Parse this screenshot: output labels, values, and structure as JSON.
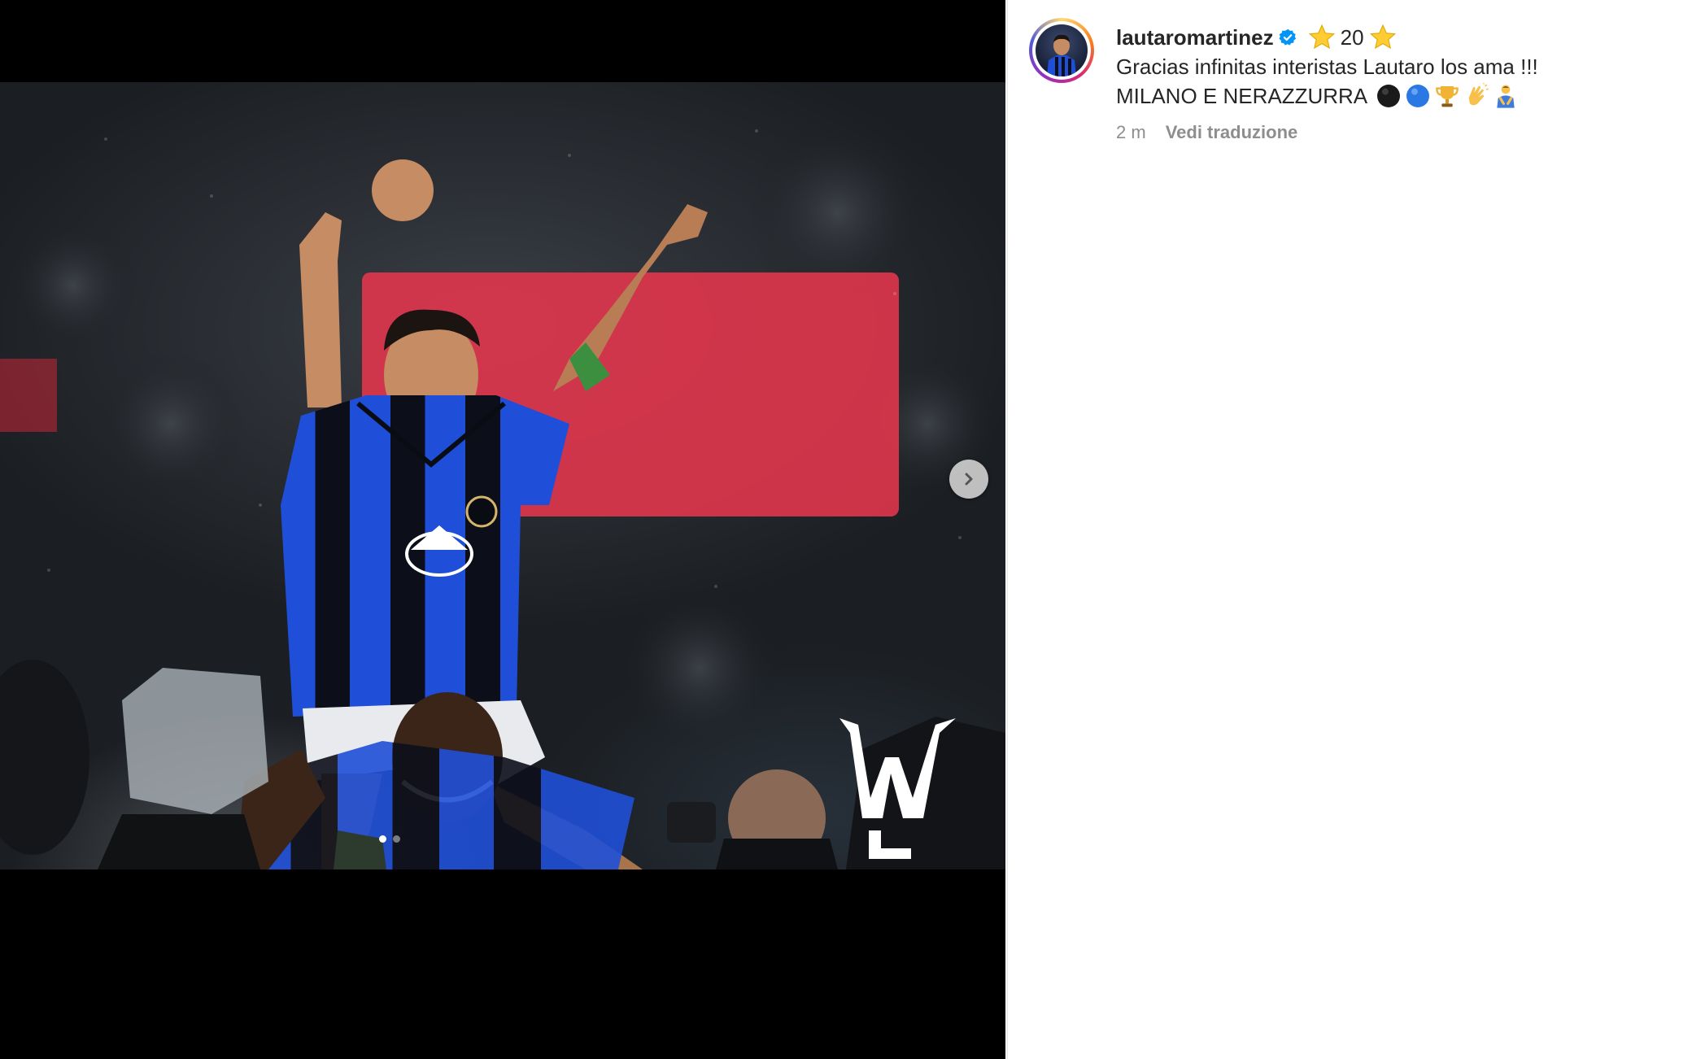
{
  "post": {
    "username": "lautaromartinez",
    "title_number": "20",
    "caption_line1": "Gracias infinitas interistas Lautaro los ama !!!",
    "caption_line2": "MILANO E NERAZZURRA",
    "timestamp": "2 m",
    "see_translation": "Vedi traduzione"
  },
  "media": {
    "watermark_letters": "ML",
    "carousel_count": 2,
    "active_index": 0
  },
  "icons": {
    "verified": "verified-badge-icon",
    "star": "star-emoji-icon",
    "caption_emojis": [
      "black-circle-emoji-icon",
      "blue-circle-emoji-icon",
      "trophy-emoji-icon",
      "clapping-hands-emoji-icon",
      "person-bowing-emoji-icon"
    ],
    "next": "chevron-right-icon"
  },
  "colors": {
    "verified_blue": "#0095f6",
    "text": "#262626",
    "secondary_text": "#8e8e8e",
    "inter_blue": "#1f4fd8"
  }
}
